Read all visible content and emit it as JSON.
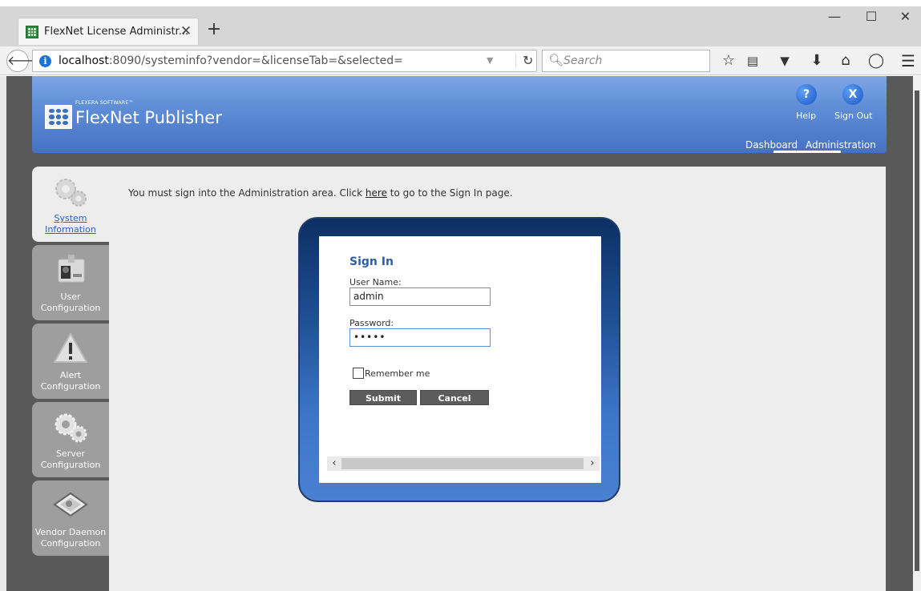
{
  "browser": {
    "tab_title": "FlexNet License Administr...",
    "new_tab": "+",
    "close_tab": "✕",
    "window": {
      "minimize": "—",
      "maximize": "☐",
      "close": "✕"
    },
    "url_host": "localhost",
    "url_rest": ":8090/systeminfo?vendor=&licenseTab=&selected=",
    "search_placeholder": "Search",
    "toolbar_icons": [
      "bookmark-star-icon",
      "reading-list-icon",
      "pocket-icon",
      "download-icon",
      "home-icon",
      "chat-icon",
      "menu-icon"
    ]
  },
  "header": {
    "brand_small": "FLEXERA SOFTWARE™",
    "brand_main": "FlexNet Publisher",
    "help_label": "Help",
    "signout_label": "Sign Out",
    "help_icon": "?",
    "signout_icon": "X",
    "nav": {
      "dashboard": "Dashboard",
      "administration": "Administration"
    }
  },
  "sidebar": {
    "items": [
      {
        "line1": "System",
        "line2": "Information",
        "active": true
      },
      {
        "line1": "User",
        "line2": "Configuration",
        "active": false
      },
      {
        "line1": "Alert",
        "line2": "Configuration",
        "active": false
      },
      {
        "line1": "Server",
        "line2": "Configuration",
        "active": false
      },
      {
        "line1": "Vendor Daemon",
        "line2": "Configuration",
        "active": false
      }
    ]
  },
  "notice": {
    "before": "You must sign into the Administration area. Click ",
    "link": "here",
    "after": " to go to the Sign In page."
  },
  "signin": {
    "title": "Sign In",
    "username_label": "User Name:",
    "username_value": "admin",
    "password_label": "Password:",
    "password_value": "•••••",
    "remember_label": "Remember me",
    "submit_label": "Submit",
    "cancel_label": "Cancel"
  },
  "colors": {
    "header_blue": "#5f8ed6",
    "frame_navy": "#0d2f63",
    "button_gray": "#5c5c5c",
    "link_blue": "#2e62b5"
  }
}
